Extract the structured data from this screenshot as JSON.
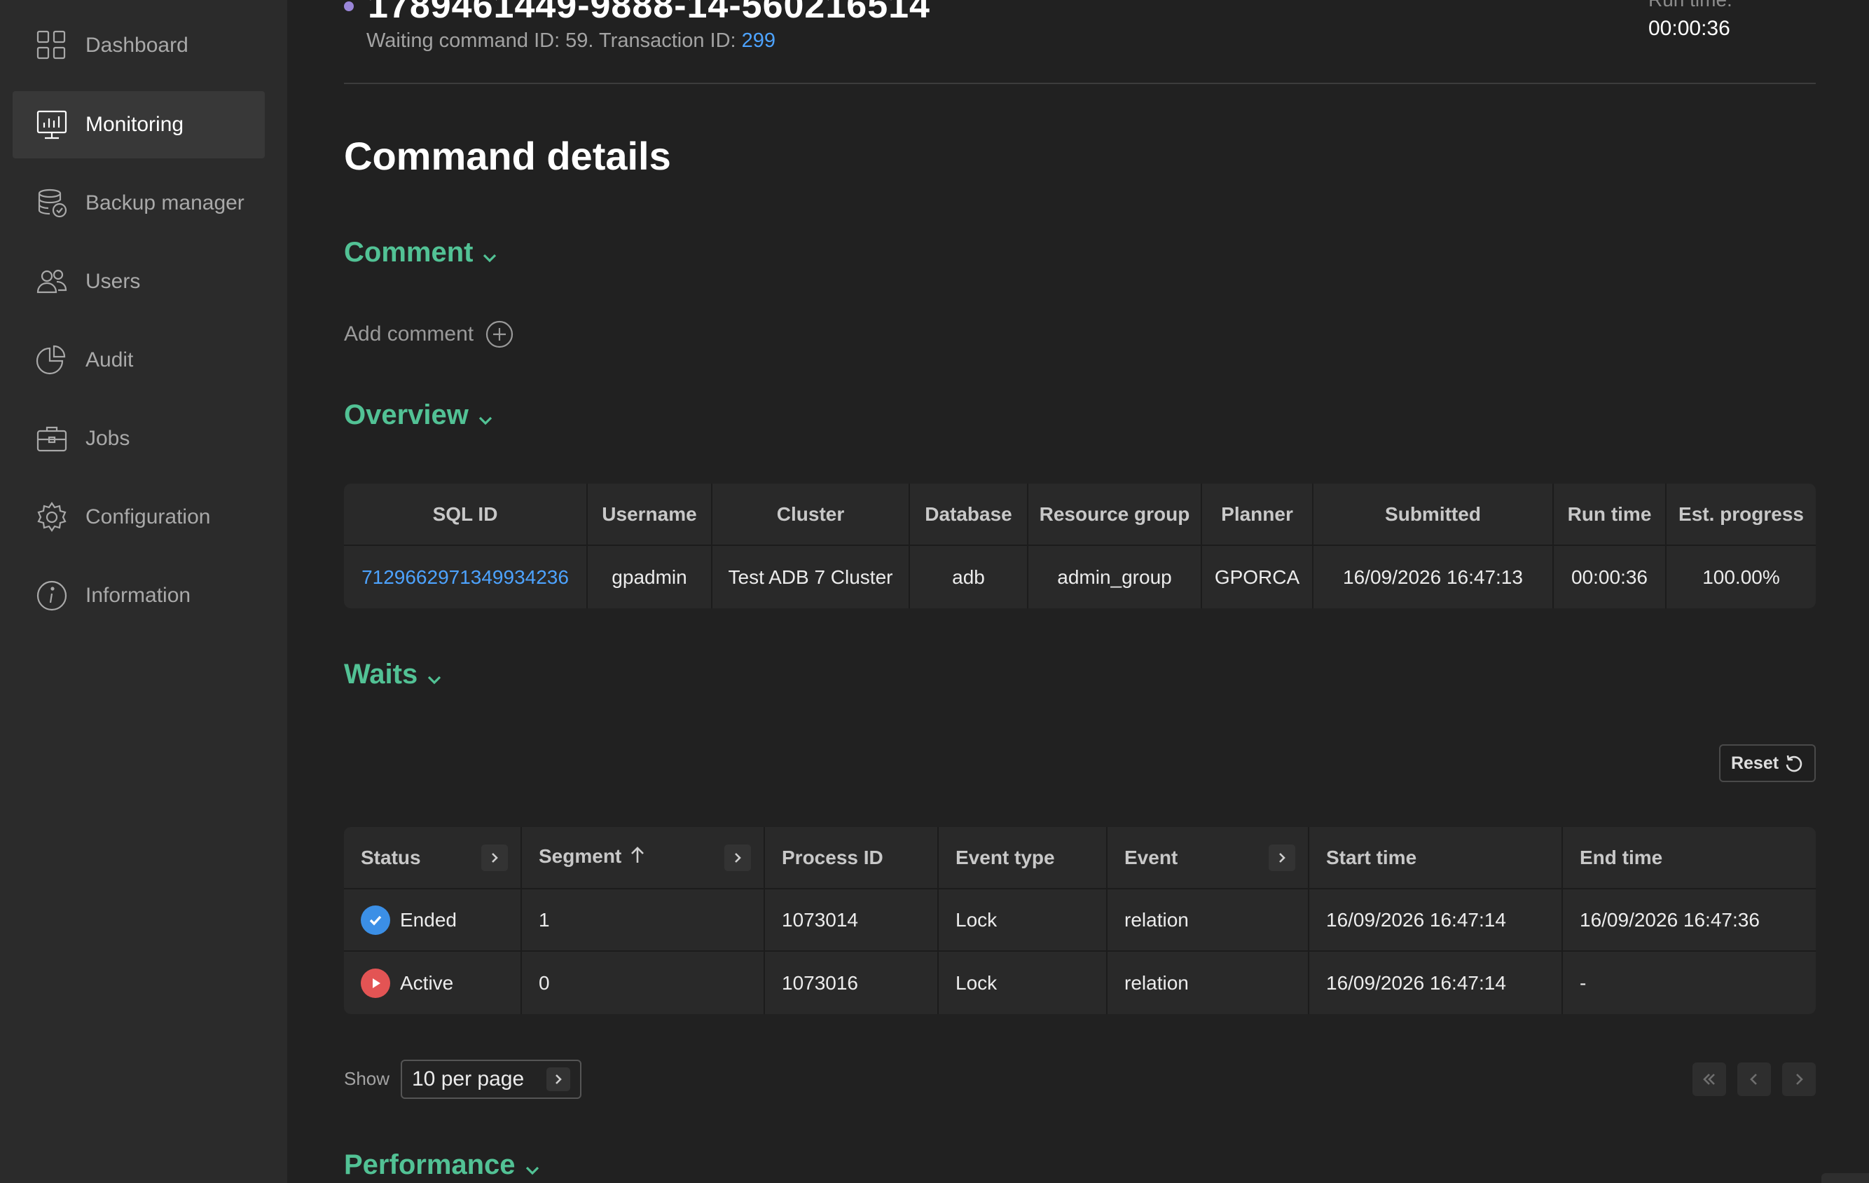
{
  "sidebar": {
    "items": [
      {
        "label": "Dashboard",
        "icon": "dashboard-icon"
      },
      {
        "label": "Monitoring",
        "icon": "monitoring-icon",
        "active": true
      },
      {
        "label": "Backup manager",
        "icon": "backup-icon"
      },
      {
        "label": "Users",
        "icon": "users-icon"
      },
      {
        "label": "Audit",
        "icon": "audit-icon"
      },
      {
        "label": "Jobs",
        "icon": "jobs-icon"
      },
      {
        "label": "Configuration",
        "icon": "gear-icon"
      },
      {
        "label": "Information",
        "icon": "info-icon"
      }
    ]
  },
  "header": {
    "job_id": "1789461449-9888-14-560216514",
    "waiting_text": "Waiting command ID: 59. Transaction ID: ",
    "transaction_id": "299",
    "runtime_label": "Run time:",
    "runtime_value": "00:00:36"
  },
  "page_title": "Command details",
  "sections": {
    "comment": "Comment",
    "add_comment": "Add comment",
    "overview": "Overview",
    "waits": "Waits",
    "performance": "Performance"
  },
  "overview": {
    "headers": [
      "SQL ID",
      "Username",
      "Cluster",
      "Database",
      "Resource group",
      "Planner",
      "Submitted",
      "Run time",
      "Est. progress"
    ],
    "row": [
      "7129662971349934236",
      "gpadmin",
      "Test ADB 7 Cluster",
      "adb",
      "admin_group",
      "GPORCA",
      "16/09/2026 16:47:13",
      "00:00:36",
      "100.00%"
    ]
  },
  "waits": {
    "reset_label": "Reset",
    "headers": [
      "Status",
      "Segment",
      "Process ID",
      "Event type",
      "Event",
      "Start time",
      "End time"
    ],
    "rows": [
      {
        "status": "Ended",
        "status_color": "#3b8fe6",
        "segment": "1",
        "process_id": "1073014",
        "event_type": "Lock",
        "event": "relation",
        "start": "16/09/2026 16:47:14",
        "end": "16/09/2026 16:47:36"
      },
      {
        "status": "Active",
        "status_color": "#e35454",
        "segment": "0",
        "process_id": "1073016",
        "event_type": "Lock",
        "event": "relation",
        "start": "16/09/2026 16:47:14",
        "end": "-"
      }
    ]
  },
  "pagination": {
    "show_label": "Show",
    "per_page": "10 per page"
  }
}
